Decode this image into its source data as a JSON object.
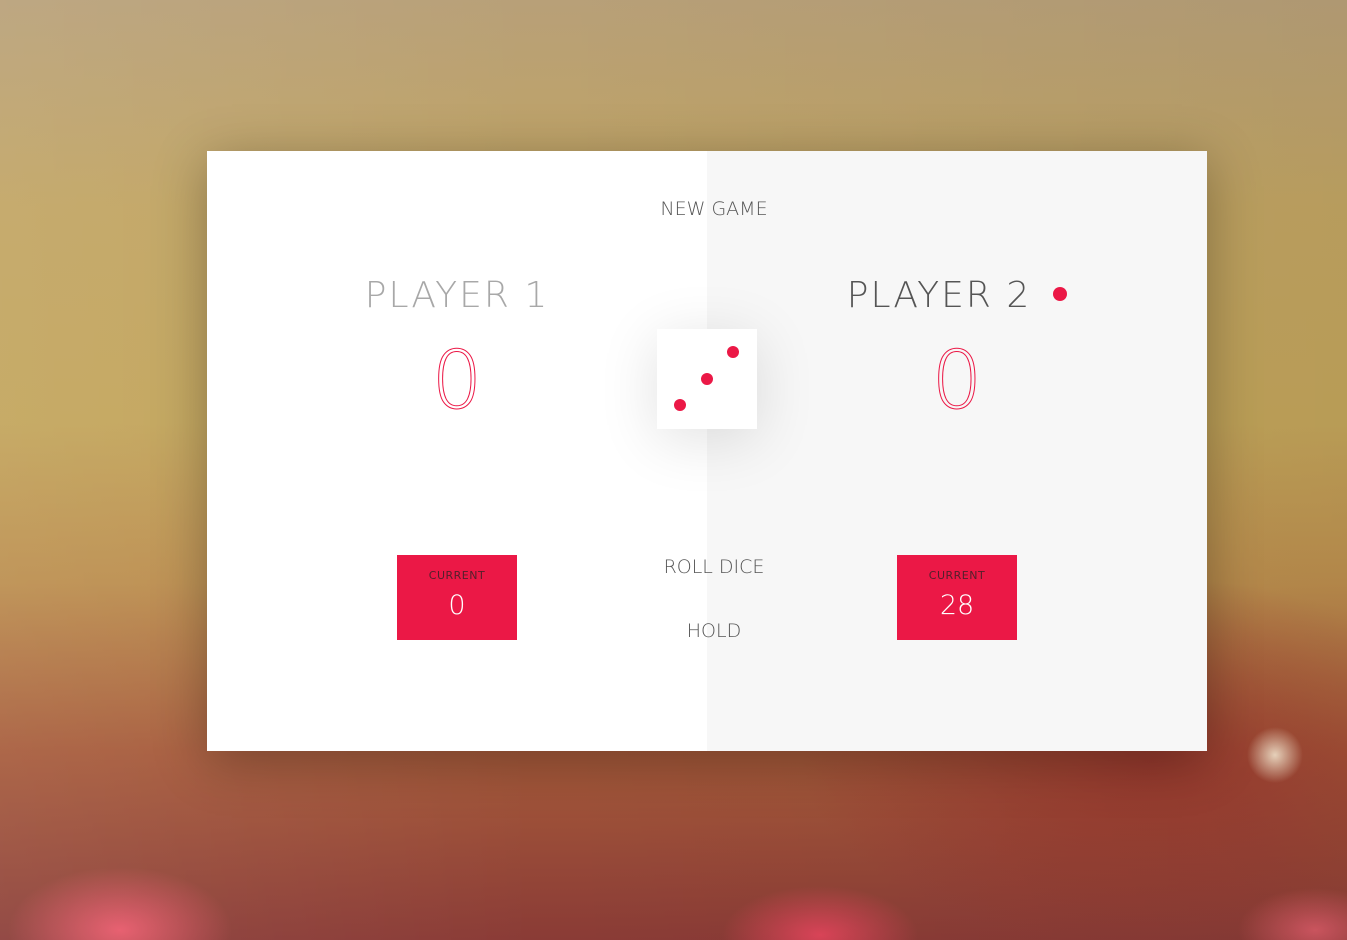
{
  "buttons": {
    "new_game": "NEW GAME",
    "roll_dice": "ROLL DICE",
    "hold": "HOLD"
  },
  "players": [
    {
      "name": "PLAYER 1",
      "score": "0",
      "current_label": "CURRENT",
      "current_score": "0",
      "active": false
    },
    {
      "name": "PLAYER 2",
      "score": "0",
      "current_label": "CURRENT",
      "current_score": "28",
      "active": true
    }
  ],
  "dice": {
    "value": 3,
    "face_color": "#ffffff",
    "pip_color": "#EB1846"
  },
  "colors": {
    "accent": "#EB1846",
    "panel_left": "#ffffff",
    "panel_right": "#f7f7f7",
    "text": "#555555"
  }
}
